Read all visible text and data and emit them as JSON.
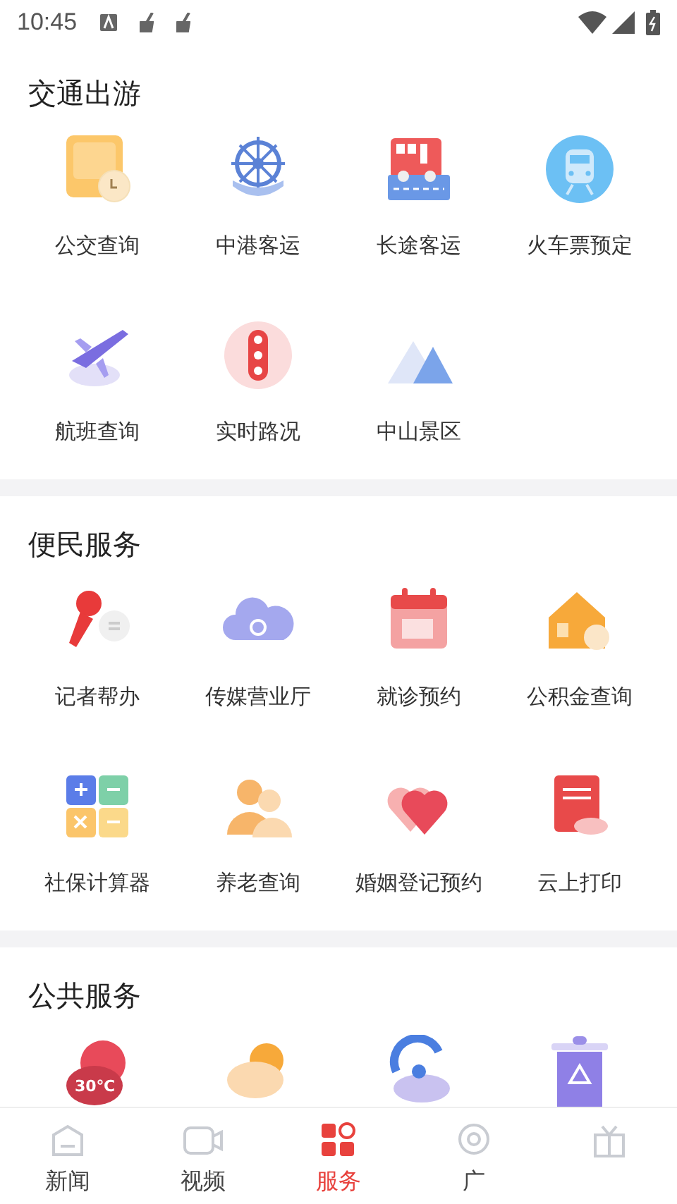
{
  "status_bar": {
    "time": "10:45"
  },
  "sections": [
    {
      "title": "交通出游",
      "items": [
        {
          "kind": "bus",
          "label": "公交查询"
        },
        {
          "kind": "wheel",
          "label": "中港客运"
        },
        {
          "kind": "coach",
          "label": "长途客运"
        },
        {
          "kind": "train",
          "label": "火车票预定"
        },
        {
          "kind": "plane",
          "label": "航班查询"
        },
        {
          "kind": "light",
          "label": "实时路况"
        },
        {
          "kind": "mount",
          "label": "中山景区"
        }
      ]
    },
    {
      "title": "便民服务",
      "items": [
        {
          "kind": "mic",
          "label": "记者帮办"
        },
        {
          "kind": "cloud",
          "label": "传媒营业厅"
        },
        {
          "kind": "calendar",
          "label": "就诊预约"
        },
        {
          "kind": "house",
          "label": "公积金查询"
        },
        {
          "kind": "calc",
          "label": "社保计算器"
        },
        {
          "kind": "people",
          "label": "养老查询"
        },
        {
          "kind": "heart",
          "label": "婚姻登记预约"
        },
        {
          "kind": "print",
          "label": "云上打印"
        }
      ]
    },
    {
      "title": "公共服务",
      "items": [
        {
          "kind": "weather",
          "temperature": "30℃"
        },
        {
          "kind": "sun"
        },
        {
          "kind": "storm"
        },
        {
          "kind": "bin"
        }
      ]
    }
  ],
  "bottom_nav": [
    {
      "label": "新闻",
      "selected": false
    },
    {
      "label": "视频",
      "selected": false
    },
    {
      "label": "服务",
      "selected": true
    },
    {
      "label": "广",
      "selected": false
    },
    {
      "selected": false
    }
  ]
}
